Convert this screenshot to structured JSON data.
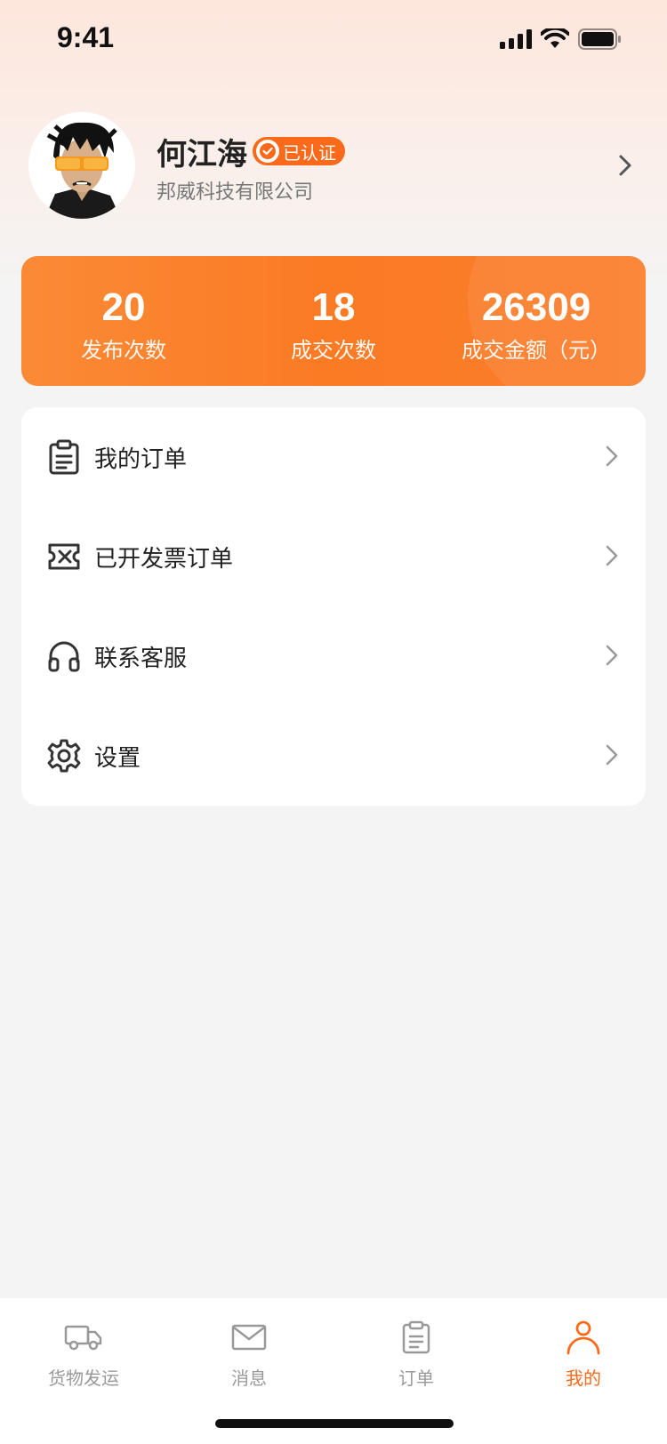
{
  "status_bar": {
    "time": "9:41"
  },
  "profile": {
    "name": "何江海",
    "verified_label": "已认证",
    "company": "邦威科技有限公司"
  },
  "stats": [
    {
      "value": "20",
      "label": "发布次数"
    },
    {
      "value": "18",
      "label": "成交次数"
    },
    {
      "value": "26309",
      "label": "成交金额（元）"
    }
  ],
  "menu": {
    "items": [
      {
        "label": "我的订单",
        "icon": "clipboard-icon"
      },
      {
        "label": "已开发票订单",
        "icon": "ticket-icon"
      },
      {
        "label": "联系客服",
        "icon": "headset-icon"
      },
      {
        "label": "设置",
        "icon": "gear-icon"
      }
    ]
  },
  "tabbar": {
    "tabs": [
      {
        "label": "货物发运",
        "icon": "truck-icon",
        "active": false
      },
      {
        "label": "消息",
        "icon": "mail-icon",
        "active": false
      },
      {
        "label": "订单",
        "icon": "clipboard-icon",
        "active": false
      },
      {
        "label": "我的",
        "icon": "user-icon",
        "active": true
      }
    ]
  },
  "colors": {
    "accent": "#fb6a1a",
    "stats_gradient_start": "#fb8a36",
    "stats_gradient_end": "#fb7e2c",
    "inactive_tab": "#999999"
  }
}
